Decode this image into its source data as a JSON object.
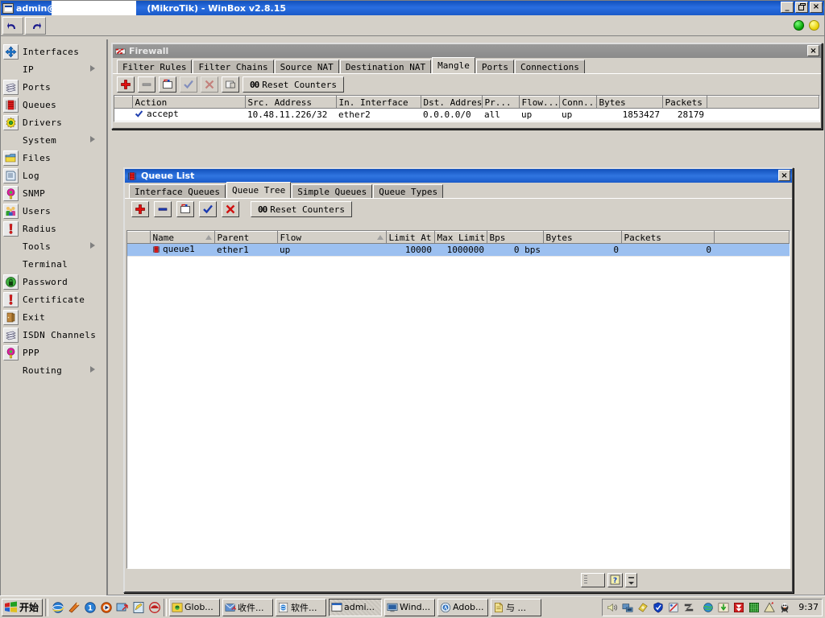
{
  "window": {
    "title_prefix": "admin@",
    "title_suffix": "(MikroTik) - WinBox v2.8.15",
    "title_icon": "winbox-icon",
    "minimize_label": "_",
    "maximize_label": "□",
    "close_label": "×",
    "toolbar": {
      "undo_label": "undo-icon",
      "redo_label": "redo-icon"
    },
    "status_dots": [
      {
        "name": "connection-ok",
        "color": "#00a000"
      },
      {
        "name": "activity",
        "color": "#e8d000"
      }
    ]
  },
  "sidebar": {
    "items": [
      {
        "label": "Interfaces",
        "icon": "interfaces-icon",
        "framed": true,
        "submenu": false
      },
      {
        "label": "IP",
        "icon": "none",
        "framed": false,
        "submenu": true
      },
      {
        "label": "Ports",
        "icon": "ports-icon",
        "framed": true,
        "submenu": false
      },
      {
        "label": "Queues",
        "icon": "queues-icon",
        "framed": true,
        "submenu": false
      },
      {
        "label": "Drivers",
        "icon": "drivers-icon",
        "framed": true,
        "submenu": false
      },
      {
        "label": "System",
        "icon": "none",
        "framed": false,
        "submenu": true
      },
      {
        "label": "Files",
        "icon": "files-icon",
        "framed": true,
        "submenu": false
      },
      {
        "label": "Log",
        "icon": "log-icon",
        "framed": true,
        "submenu": false
      },
      {
        "label": "SNMP",
        "icon": "snmp-icon",
        "framed": true,
        "submenu": false
      },
      {
        "label": "Users",
        "icon": "users-icon",
        "framed": true,
        "submenu": false
      },
      {
        "label": "Radius",
        "icon": "radius-icon",
        "framed": true,
        "submenu": false
      },
      {
        "label": "Tools",
        "icon": "none",
        "framed": false,
        "submenu": true
      },
      {
        "label": "Terminal",
        "icon": "none",
        "framed": false,
        "submenu": false
      },
      {
        "label": "Password",
        "icon": "password-icon",
        "framed": true,
        "submenu": false
      },
      {
        "label": "Certificate",
        "icon": "certificate-icon",
        "framed": true,
        "submenu": false
      },
      {
        "label": "Exit",
        "icon": "exit-icon",
        "framed": true,
        "submenu": false
      },
      {
        "label": "ISDN Channels",
        "icon": "isdn-icon",
        "framed": true,
        "submenu": false
      },
      {
        "label": "PPP",
        "icon": "ppp-icon",
        "framed": true,
        "submenu": false
      },
      {
        "label": "Routing",
        "icon": "none",
        "framed": false,
        "submenu": true
      }
    ]
  },
  "firewall_window": {
    "title": "Firewall",
    "icon": "firewall-icon",
    "close_label": "×",
    "tabs": [
      {
        "label": "Filter Rules",
        "active": false
      },
      {
        "label": "Filter Chains",
        "active": false
      },
      {
        "label": "Source NAT",
        "active": false
      },
      {
        "label": "Destination NAT",
        "active": false
      },
      {
        "label": "Mangle",
        "active": true
      },
      {
        "label": "Ports",
        "active": false
      },
      {
        "label": "Connections",
        "active": false
      }
    ],
    "toolbar": {
      "add_label": "add-icon",
      "remove_label": "remove-icon",
      "comment_label": "comment-icon",
      "enable_label": "enable-icon",
      "disable_label": "disable-icon",
      "copy_label": "copy-icon",
      "reset_counters_prefix": "00",
      "reset_counters_label": "Reset Counters"
    },
    "table": {
      "columns": [
        "",
        "Action",
        "Src. Address",
        "In. Interface",
        "Dst. Address",
        "Pr...",
        "Flow...",
        "Conn...",
        "Bytes",
        "Packets",
        ""
      ],
      "rows": [
        {
          "marker": "",
          "action": "accept",
          "action_icon": "checkmark-icon",
          "src_address": "10.48.11.226/32",
          "in_interface": "ether2",
          "dst_address": "0.0.0.0/0",
          "protocol": "all",
          "flow": "up",
          "connection": "up",
          "bytes": "1853427",
          "packets": "28179",
          "extra": ""
        }
      ]
    }
  },
  "queue_window": {
    "title": "Queue List",
    "icon": "queues-icon",
    "close_label": "×",
    "tabs": [
      {
        "label": "Interface Queues",
        "active": false
      },
      {
        "label": "Queue Tree",
        "active": true
      },
      {
        "label": "Simple Queues",
        "active": false
      },
      {
        "label": "Queue Types",
        "active": false
      }
    ],
    "toolbar": {
      "add_label": "add-icon",
      "remove_label": "remove-icon",
      "comment_label": "comment-icon",
      "enable_label": "enable-icon",
      "disable_label": "disable-icon",
      "reset_counters_prefix": "00",
      "reset_counters_label": "Reset Counters"
    },
    "table": {
      "columns": [
        "",
        "Name",
        "Parent",
        "Flow",
        "Limit At",
        "Max Limit",
        "Bps",
        "Bytes",
        "Packets",
        ""
      ],
      "sorted_columns": [
        "Name",
        "Flow"
      ],
      "rows": [
        {
          "marker": "",
          "name": "queue1",
          "name_icon": "queue-icon",
          "parent": "ether1",
          "flow": "up",
          "limit_at": "10000",
          "max_limit": "1000000",
          "bps": "0 bps",
          "bytes": "0",
          "packets": "0",
          "extra": "",
          "selected": true
        }
      ]
    },
    "statusbar": {
      "grip_label": "resize-grip",
      "help_label": "?",
      "spinner_label": "spin-control"
    }
  },
  "taskbar": {
    "start_label": "开始",
    "start_icon": "windows-flag-icon",
    "quick_launch": [
      {
        "name": "internet-explorer-icon",
        "color": "#1a6fd4"
      },
      {
        "name": "media-player-icon",
        "color": "#e07820"
      },
      {
        "name": "realplayer-icon",
        "color": "#1a6fd4"
      },
      {
        "name": "winamp-icon",
        "color": "#e05a00"
      },
      {
        "name": "show-desktop-icon",
        "color": "#2a7fd4"
      },
      {
        "name": "notepad-icon",
        "color": "#3a8fd4"
      },
      {
        "name": "netease-icon",
        "color": "#c02020"
      }
    ],
    "tasks": [
      {
        "label": "Glob...",
        "icon": "globalscape-icon",
        "active": false
      },
      {
        "label": "收件...",
        "icon": "outlook-icon",
        "active": false
      },
      {
        "label": "软件...",
        "icon": "ie-folder-icon",
        "active": false
      },
      {
        "label": "admi...",
        "icon": "winbox-icon",
        "active": true
      },
      {
        "label": "Wind...",
        "icon": "explorer-icon",
        "active": false
      },
      {
        "label": "Adob...",
        "icon": "acrobat-icon",
        "active": false
      },
      {
        "label": "与 ...",
        "icon": "document-icon",
        "active": false
      }
    ],
    "tray_icons": [
      {
        "name": "volume-icon",
        "color": "#d8d8a0"
      },
      {
        "name": "network-icon",
        "color": "#5080c0"
      },
      {
        "name": "nvidia-icon",
        "color": "#d8c020"
      },
      {
        "name": "shield-icon",
        "color": "#1040c0"
      },
      {
        "name": "antivirus-icon",
        "color": "#c03020"
      },
      {
        "name": "zonealarm-icon",
        "color": "#404040"
      },
      {
        "name": "globe-icon",
        "color": "#30a030"
      },
      {
        "name": "download-icon",
        "color": "#30b030"
      },
      {
        "name": "flashget-icon",
        "color": "#d02020"
      },
      {
        "name": "grid-icon",
        "color": "#208020"
      },
      {
        "name": "warning-icon",
        "color": "#d8c020"
      },
      {
        "name": "qq-icon",
        "color": "#202020"
      }
    ],
    "clock": "9:37"
  }
}
